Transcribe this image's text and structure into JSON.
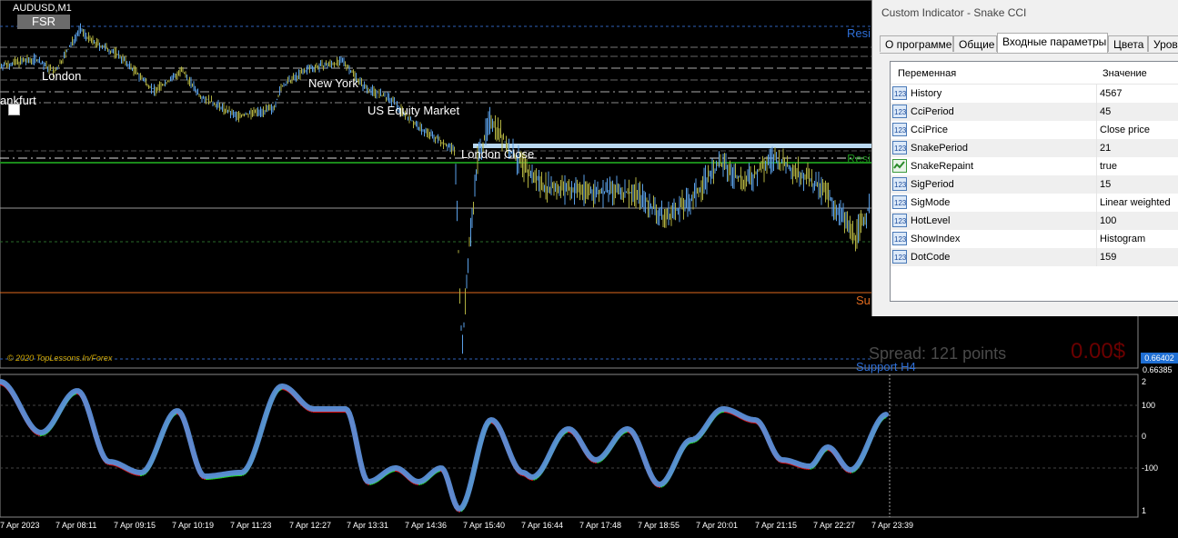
{
  "chart": {
    "symbol": "AUDUSD,M1",
    "fsr_button": "FSR",
    "sessions": [
      "London",
      "New York",
      "ankfurt",
      "US Equity Market",
      "London Close"
    ],
    "line_labels": {
      "resistance_top": "Resi",
      "resistance_mid": "Resi",
      "support_mid": "Su",
      "support_h4": "Support H4"
    },
    "copyright": "© 2020 TopLessons.In/Forex",
    "spread": "Spread: 121 points",
    "profit": "0.00$",
    "price_current": "0.66402",
    "price_low": "0.66385",
    "osc_levels": [
      "2",
      "100",
      "0",
      "-100",
      "1"
    ],
    "times": [
      "7 Apr 2023",
      "7 Apr 08:11",
      "7 Apr 09:15",
      "7 Apr 10:19",
      "7 Apr 11:23",
      "7 Apr 12:27",
      "7 Apr 13:31",
      "7 Apr 14:36",
      "7 Apr 15:40",
      "7 Apr 16:44",
      "7 Apr 17:48",
      "7 Apr 18:55",
      "7 Apr 20:01",
      "7 Apr 21:15",
      "7 Apr 22:27",
      "7 Apr 23:39"
    ],
    "colors": {
      "price_up": "#5aa0e8",
      "price_down": "#b0b040",
      "cci_line": "#5b8fd8",
      "cci_up": "#22dd22",
      "cci_down": "#dd1111",
      "support_orange": "#e06a1e",
      "green_line": "#1a8a1a"
    }
  },
  "dialog": {
    "title": "Custom Indicator - Snake CCI",
    "tabs": [
      "О программе",
      "Общие",
      "Входные параметры",
      "Цвета",
      "Уровни"
    ],
    "active_tab": "Входные параметры",
    "header": {
      "variable": "Переменная",
      "value": "Значение"
    },
    "params": [
      {
        "name": "History",
        "value": "4567",
        "icon": "int-icon"
      },
      {
        "name": "CciPeriod",
        "value": "45",
        "icon": "int-icon"
      },
      {
        "name": "CciPrice",
        "value": "Close price",
        "icon": "int-icon"
      },
      {
        "name": "SnakePeriod",
        "value": "21",
        "icon": "int-icon"
      },
      {
        "name": "SnakeRepaint",
        "value": "true",
        "icon": "bool-icon"
      },
      {
        "name": "SigPeriod",
        "value": "15",
        "icon": "int-icon"
      },
      {
        "name": "SigMode",
        "value": "Linear weighted",
        "icon": "int-icon"
      },
      {
        "name": "HotLevel",
        "value": "100",
        "icon": "int-icon"
      },
      {
        "name": "ShowIndex",
        "value": "Histogram",
        "icon": "int-icon"
      },
      {
        "name": "DotCode",
        "value": "159",
        "icon": "int-icon"
      }
    ]
  }
}
